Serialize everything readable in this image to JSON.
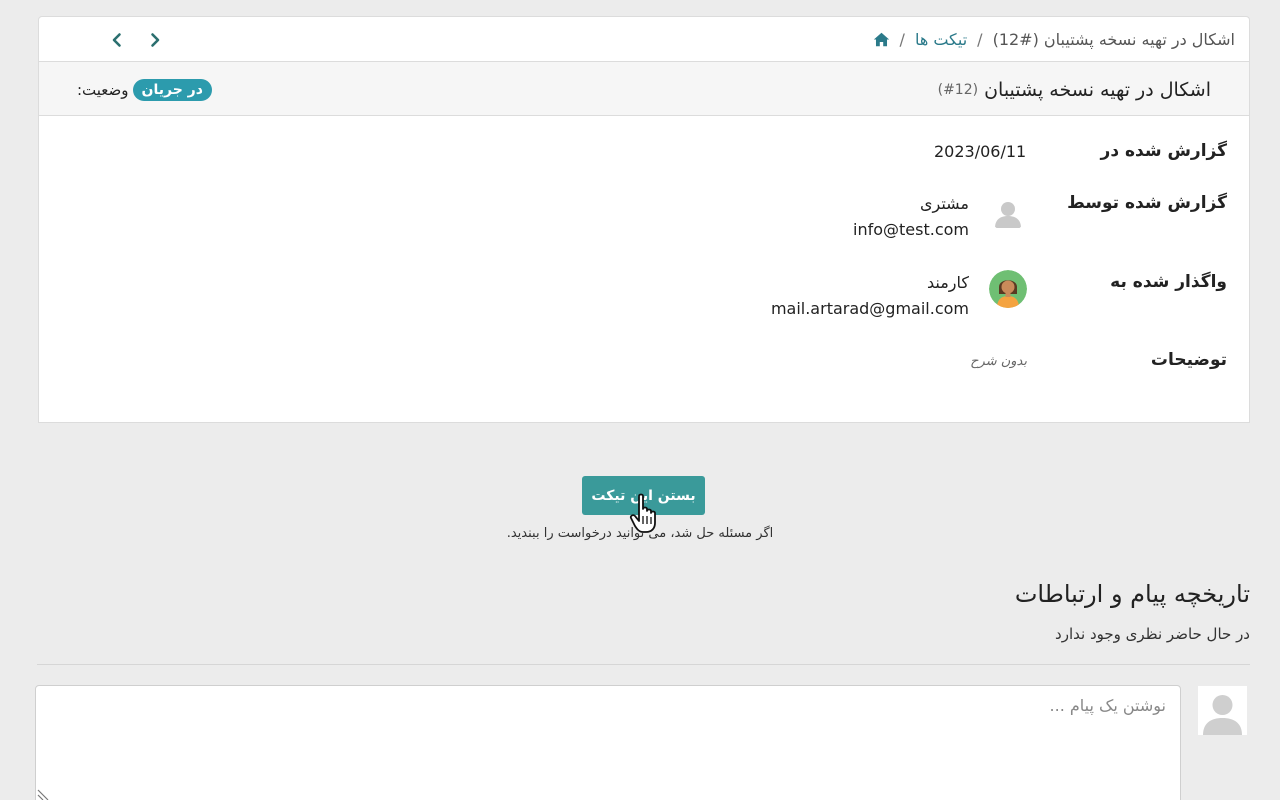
{
  "breadcrumb": {
    "home_icon": "home-icon",
    "sep1": "/",
    "tickets_link": "تیکت ها",
    "sep2": "/",
    "current": "اشکال در تهیه نسخه پشتیبان (#12)"
  },
  "pager": {
    "prev_icon": "chevron-left-icon",
    "next_icon": "chevron-right-icon"
  },
  "ticket": {
    "title": "اشکال در تهیه نسخه پشتیبان",
    "ref": "(#12)",
    "status_label": "وضعیت:",
    "status_value": "در جریان",
    "status_color": "#2c9bad",
    "fields": {
      "reported_on_label": "گزارش شده در",
      "reported_on_value": "2023/06/11",
      "reported_by_label": "گزارش شده توسط",
      "reported_by_name": "مشتری",
      "reported_by_email": "info@test.com",
      "assigned_to_label": "واگذار شده به",
      "assigned_to_name": "کارمند",
      "assigned_to_email": "mail.artarad@gmail.com",
      "description_label": "توضیحات",
      "description_value": "بدون شرح"
    }
  },
  "actions": {
    "close_button": "بستن این تیکت",
    "close_hint": "اگر مسئله حل شد، می توانید درخواست را ببندید.",
    "accent_color": "#3a9a9a"
  },
  "history": {
    "title": "تاریخچه پیام و ارتباطات",
    "empty_text": "در حال حاضر نظری وجود ندارد"
  },
  "composer": {
    "placeholder": "نوشتن یک پیام ..."
  }
}
